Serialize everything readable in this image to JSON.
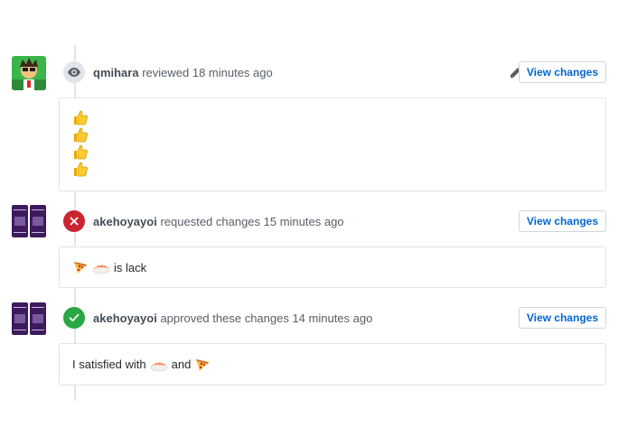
{
  "reviews": [
    {
      "author": "qmihara",
      "action": "reviewed 18 minutes ago",
      "status": "commented",
      "status_icon": "eye-icon",
      "button_label": "View changes",
      "has_edit": true,
      "body_emoji": [
        "thumbs-up",
        "thumbs-up",
        "thumbs-up",
        "thumbs-up"
      ]
    },
    {
      "author": "akehoyayoi",
      "action": "requested changes 15 minutes ago",
      "status": "changes-requested",
      "status_icon": "x-icon",
      "button_label": "View changes",
      "body_text": "is lack"
    },
    {
      "author": "akehoyayoi",
      "action": "approved these changes 14 minutes ago",
      "status": "approved",
      "status_icon": "check-icon",
      "button_label": "View changes",
      "body_text_1": "I satisfied with",
      "body_text_2": "and"
    }
  ],
  "colors": {
    "link": "#0366d6",
    "approved": "#28a745",
    "changes_requested": "#cb2431",
    "neutral_badge": "#e1e4e8",
    "border": "#e1e4e8"
  }
}
